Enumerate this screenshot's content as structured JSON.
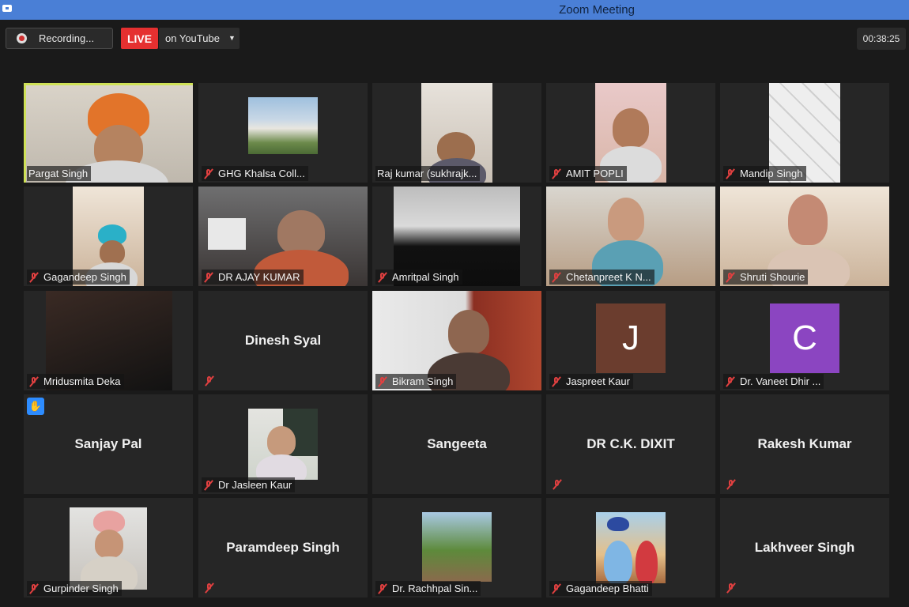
{
  "window": {
    "title": "Zoom Meeting"
  },
  "topbar": {
    "recording_label": "Recording...",
    "live_label": "LIVE",
    "stream_label": "on YouTube",
    "timer": "00:38:25"
  },
  "tiles": [
    {
      "name": "Pargat Singh"
    },
    {
      "name": "GHG Khalsa Coll..."
    },
    {
      "name": "Raj kumar (sukhrajk..."
    },
    {
      "name": "AMIT POPLI"
    },
    {
      "name": "Mandip Singh"
    },
    {
      "name": "Gagandeep Singh"
    },
    {
      "name": "DR AJAY KUMAR"
    },
    {
      "name": "Amritpal Singh"
    },
    {
      "name": "Chetanpreet K N..."
    },
    {
      "name": "Shruti Shourie"
    },
    {
      "name": "Mridusmita Deka"
    },
    {
      "name": "Dinesh Syal"
    },
    {
      "name": "Bikram Singh"
    },
    {
      "name": "Jaspreet Kaur",
      "avatar_letter": "J",
      "avatar_color": "#6b3d2e"
    },
    {
      "name": "Dr. Vaneet Dhir ...",
      "avatar_letter": "C",
      "avatar_color": "#8b45c1"
    },
    {
      "name": "Sanjay Pal"
    },
    {
      "name": "Dr Jasleen Kaur"
    },
    {
      "name": "Sangeeta"
    },
    {
      "name": "DR C.K. DIXIT"
    },
    {
      "name": "Rakesh Kumar"
    },
    {
      "name": "Gurpinder Singh"
    },
    {
      "name": "Paramdeep Singh"
    },
    {
      "name": "Dr. Rachhpal Sin..."
    },
    {
      "name": "Gagandeep Bhatti"
    },
    {
      "name": "Lakhveer Singh"
    }
  ]
}
